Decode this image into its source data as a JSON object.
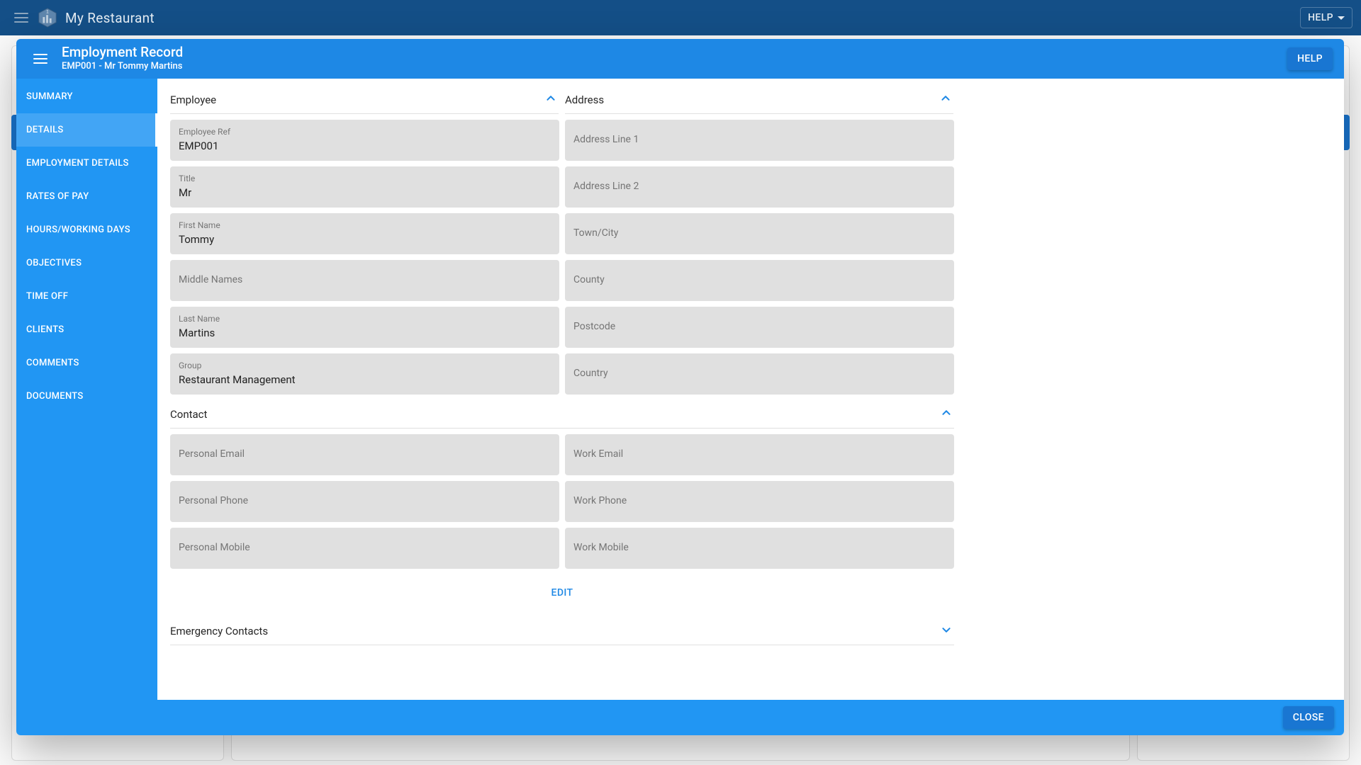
{
  "appbar": {
    "title": "My Restaurant",
    "help_label": "HELP",
    "logo_badge": "1"
  },
  "modal": {
    "title": "Employment Record",
    "subtitle": "EMP001 - Mr Tommy Martins",
    "help_label": "HELP",
    "close_label": "CLOSE",
    "edit_label": "EDIT"
  },
  "sidebar": {
    "items": [
      {
        "label": "SUMMARY"
      },
      {
        "label": "DETAILS"
      },
      {
        "label": "EMPLOYMENT DETAILS"
      },
      {
        "label": "RATES OF PAY"
      },
      {
        "label": "HOURS/WORKING DAYS"
      },
      {
        "label": "OBJECTIVES"
      },
      {
        "label": "TIME OFF"
      },
      {
        "label": "CLIENTS"
      },
      {
        "label": "COMMENTS"
      },
      {
        "label": "DOCUMENTS"
      }
    ],
    "active_index": 1
  },
  "sections": {
    "employee": {
      "heading": "Employee",
      "expanded": true,
      "fields": [
        {
          "label": "Employee Ref",
          "value": "EMP001"
        },
        {
          "label": "Title",
          "value": "Mr"
        },
        {
          "label": "First Name",
          "value": "Tommy"
        },
        {
          "label": "Middle Names",
          "value": ""
        },
        {
          "label": "Last Name",
          "value": "Martins"
        },
        {
          "label": "Group",
          "value": "Restaurant Management"
        }
      ]
    },
    "address": {
      "heading": "Address",
      "expanded": true,
      "fields": [
        {
          "label": "Address Line 1",
          "value": ""
        },
        {
          "label": "Address Line 2",
          "value": ""
        },
        {
          "label": "Town/City",
          "value": ""
        },
        {
          "label": "County",
          "value": ""
        },
        {
          "label": "Postcode",
          "value": ""
        },
        {
          "label": "Country",
          "value": ""
        }
      ]
    },
    "contact": {
      "heading": "Contact",
      "expanded": true,
      "left": [
        {
          "label": "Personal Email",
          "value": ""
        },
        {
          "label": "Personal Phone",
          "value": ""
        },
        {
          "label": "Personal Mobile",
          "value": ""
        }
      ],
      "right": [
        {
          "label": "Work Email",
          "value": ""
        },
        {
          "label": "Work Phone",
          "value": ""
        },
        {
          "label": "Work Mobile",
          "value": ""
        }
      ]
    },
    "emergency": {
      "heading": "Emergency Contacts",
      "expanded": false
    }
  },
  "colors": {
    "appbar": "#144f87",
    "modal_header": "#1e88e5",
    "sidebar": "#2196f3",
    "sidebar_active": "#42a5f5",
    "primary_button": "#1976d2",
    "field_bg": "#e0e0e0",
    "link": "#1e88e5"
  }
}
